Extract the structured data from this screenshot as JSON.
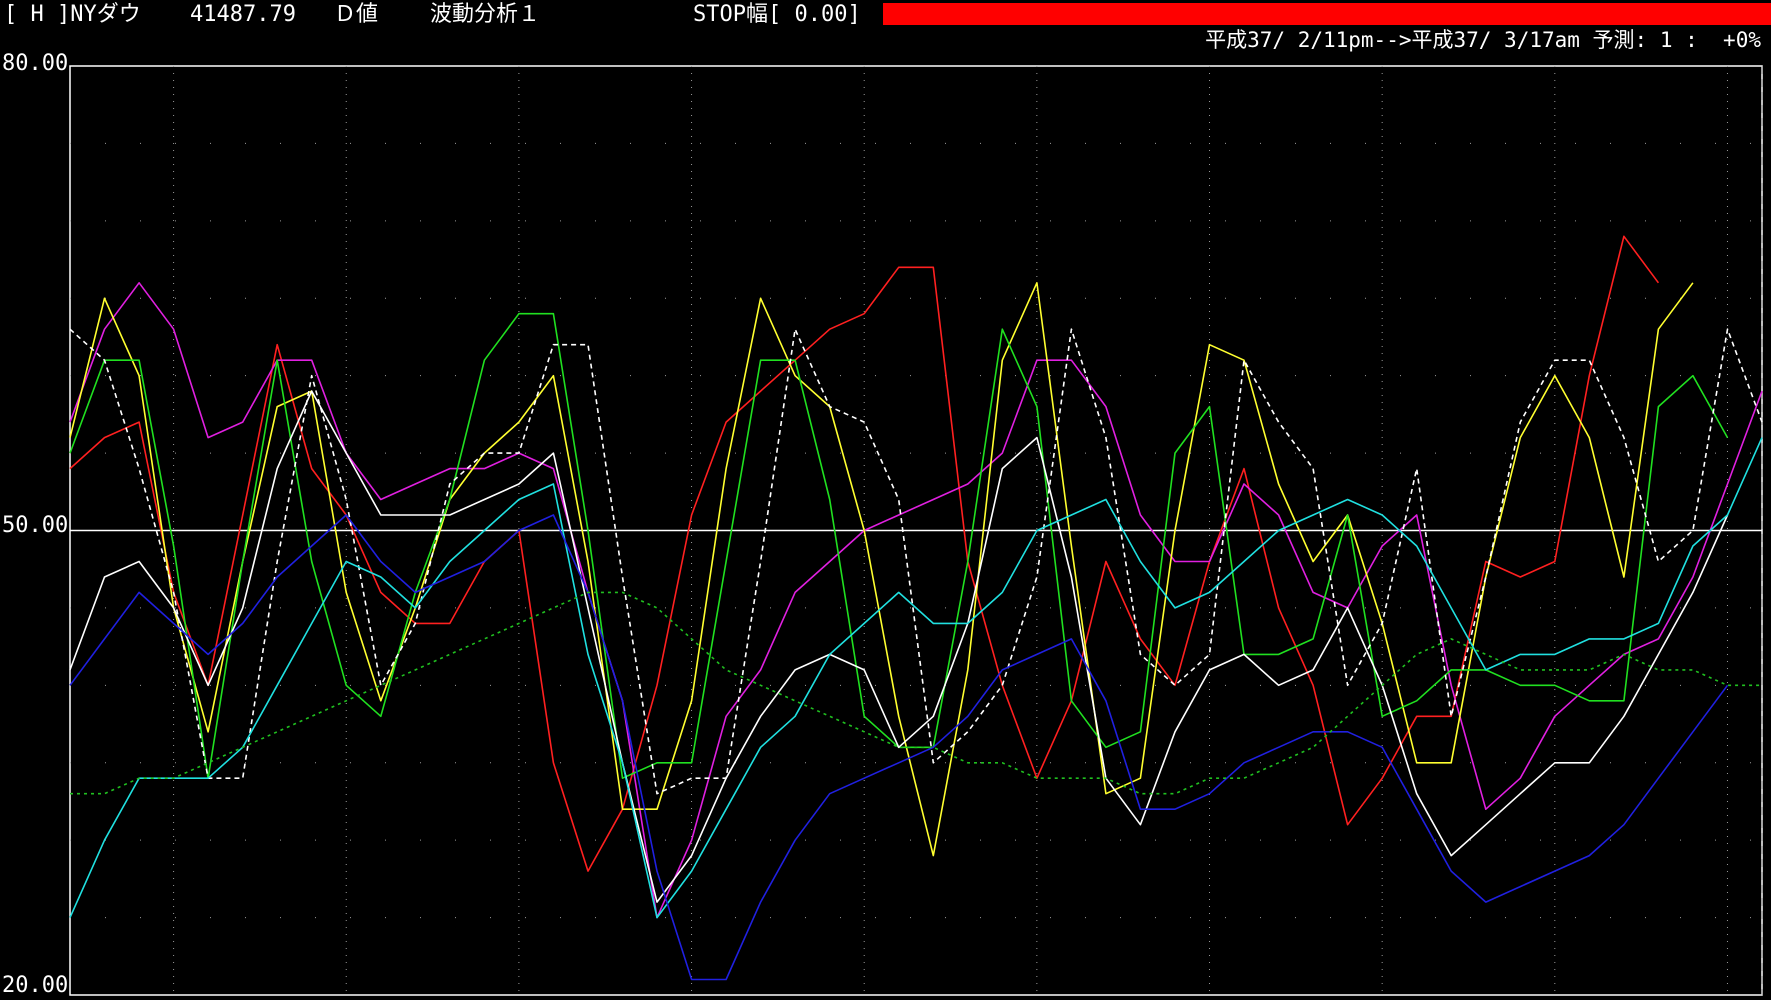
{
  "header": {
    "item1": "[ H ]NYダウ",
    "price": "41487.79",
    "value_type": "Ｄ値",
    "analysis": "波動分析１",
    "stop": "STOP幅[ 0.00]",
    "period_info": "平成37/ 2/11pm-->平成37/ 3/17am 予測: 1 :  +0%",
    "bar_color": "#ff0000"
  },
  "chart_data": {
    "type": "line",
    "ylim": [
      20,
      80
    ],
    "yticks": [
      "80.00",
      "50.00",
      "20.00"
    ],
    "x_count": 50,
    "forecast_index": 49,
    "midline": 50,
    "grid": true,
    "series": [
      {
        "color": "#ff2020",
        "style": "solid",
        "values": [
          54,
          56,
          57,
          46,
          40,
          51,
          62,
          54,
          51,
          46,
          44,
          44,
          48,
          50,
          35,
          28,
          32,
          40,
          51,
          57,
          59,
          61,
          63,
          64,
          67,
          67,
          48,
          40,
          34,
          39,
          48,
          43,
          40,
          48,
          54,
          45,
          40,
          31,
          34,
          38,
          38,
          48,
          47,
          48,
          60,
          69,
          66
        ]
      },
      {
        "color": "#e020e0",
        "style": "solid",
        "values": [
          57,
          63,
          66,
          63,
          56,
          57,
          61,
          61,
          55,
          52,
          53,
          54,
          54,
          55,
          54,
          46,
          39,
          25,
          30,
          38,
          41,
          46,
          48,
          50,
          51,
          52,
          53,
          55,
          61,
          61,
          58,
          51,
          48,
          48,
          53,
          51,
          46,
          45,
          49,
          51,
          40,
          32,
          34,
          38,
          40,
          42,
          43,
          47,
          53,
          59
        ]
      },
      {
        "color": "#ffff30",
        "style": "solid",
        "values": [
          56,
          65,
          60,
          45,
          37,
          48,
          58,
          59,
          46,
          39,
          45,
          52,
          55,
          57,
          60,
          48,
          32,
          32,
          39,
          54,
          65,
          60,
          58,
          50,
          38,
          29,
          41,
          61,
          66,
          49,
          33,
          34,
          50,
          62,
          61,
          53,
          48,
          51,
          44,
          35,
          35,
          47,
          56,
          60,
          56,
          47,
          63,
          66
        ]
      },
      {
        "color": "#20e020",
        "style": "solid",
        "values": [
          55,
          61,
          61,
          49,
          34,
          48,
          61,
          48,
          40,
          38,
          46,
          52,
          61,
          64,
          64,
          50,
          34,
          35,
          35,
          48,
          61,
          61,
          52,
          38,
          36,
          36,
          48,
          63,
          58,
          39,
          36,
          37,
          55,
          58,
          42,
          42,
          43,
          51,
          38,
          39,
          41,
          41,
          40,
          40,
          39,
          39,
          58,
          60,
          56
        ]
      },
      {
        "color": "#ffffff",
        "style": "dashed",
        "values": [
          63,
          61,
          54,
          46,
          34,
          34,
          48,
          60,
          52,
          40,
          44,
          53,
          55,
          55,
          62,
          62,
          47,
          33,
          34,
          34,
          48,
          63,
          58,
          57,
          52,
          35,
          37,
          40,
          47,
          63,
          56,
          42,
          40,
          42,
          61,
          57,
          54,
          40,
          44,
          54,
          38,
          47,
          57,
          61,
          61,
          56,
          48,
          50,
          63,
          57
        ]
      },
      {
        "color": "#ffffff",
        "style": "solid",
        "values": [
          41,
          47,
          48,
          45,
          40,
          45,
          54,
          59,
          55,
          51,
          51,
          51,
          52,
          53,
          55,
          45,
          35,
          26,
          29,
          34,
          38,
          41,
          42,
          41,
          36,
          38,
          44,
          54,
          56,
          47,
          34,
          31,
          37,
          41,
          42,
          40,
          41,
          45,
          40,
          33,
          29,
          31,
          33,
          35,
          35,
          38,
          42,
          46,
          51
        ]
      },
      {
        "color": "#20e0e0",
        "style": "solid",
        "values": [
          25,
          30,
          34,
          34,
          34,
          36,
          40,
          44,
          48,
          47,
          45,
          48,
          50,
          52,
          53,
          42,
          35,
          25,
          28,
          32,
          36,
          38,
          42,
          44,
          46,
          44,
          44,
          46,
          50,
          51,
          52,
          48,
          45,
          46,
          48,
          50,
          51,
          52,
          51,
          49,
          45,
          41,
          42,
          42,
          43,
          43,
          44,
          49,
          51,
          56
        ]
      },
      {
        "color": "#2020e0",
        "style": "solid",
        "values": [
          40,
          43,
          46,
          44,
          42,
          44,
          47,
          49,
          51,
          48,
          46,
          47,
          48,
          50,
          51,
          46,
          39,
          28,
          21,
          21,
          26,
          30,
          33,
          34,
          35,
          36,
          38,
          41,
          42,
          43,
          39,
          32,
          32,
          33,
          35,
          36,
          37,
          37,
          36,
          32,
          28,
          26,
          27,
          28,
          29,
          31,
          34,
          37,
          40
        ]
      },
      {
        "color": "#20c020",
        "style": "dotted",
        "values": [
          33,
          33,
          34,
          34,
          35,
          36,
          37,
          38,
          39,
          40,
          41,
          42,
          43,
          44,
          45,
          46,
          46,
          45,
          43,
          41,
          40,
          39,
          38,
          37,
          36,
          36,
          35,
          35,
          34,
          34,
          34,
          33,
          33,
          34,
          34,
          35,
          36,
          38,
          40,
          42,
          43,
          42,
          41,
          41,
          41,
          42,
          41,
          41,
          40,
          40
        ]
      }
    ]
  }
}
